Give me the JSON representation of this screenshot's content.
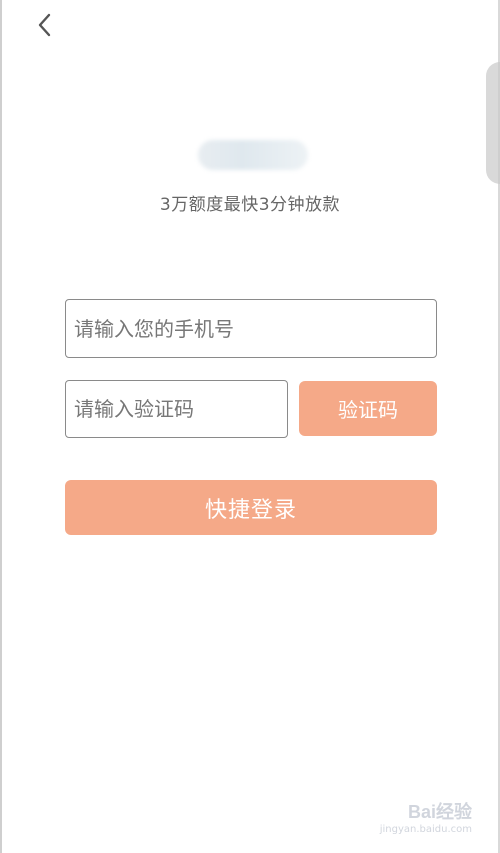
{
  "header": {
    "back_icon": "chevron-left-icon"
  },
  "brand": {
    "tagline": "3万额度最快3分钟放款"
  },
  "form": {
    "phone_placeholder": "请输入您的手机号",
    "code_placeholder": "请输入验证码",
    "get_code_label": "验证码",
    "login_label": "快捷登录"
  },
  "colors": {
    "accent": "#f5a988",
    "border": "#8a8a8a",
    "tagline": "#666666"
  },
  "watermark": {
    "logo_text": "Bai经验",
    "url_text": "jingyan.baidu.com"
  }
}
